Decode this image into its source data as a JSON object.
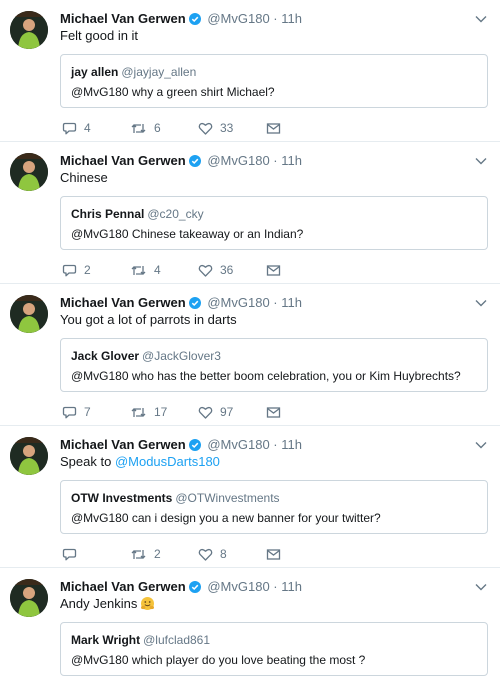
{
  "colors": {
    "accent": "#1da1f2",
    "text": "#14171a",
    "muted": "#657786",
    "border": "#ccd6dd"
  },
  "tweets": [
    {
      "name": "Michael Van Gerwen",
      "handle": "@MvG180",
      "time": "11h",
      "text": "Felt good in it",
      "mention": "",
      "emoji": "",
      "quote": {
        "name": "jay allen",
        "handle": "@jayjay_allen",
        "text": "@MvG180 why a green shirt Michael?"
      },
      "replies": "4",
      "retweets": "6",
      "likes": "33"
    },
    {
      "name": "Michael Van Gerwen",
      "handle": "@MvG180",
      "time": "11h",
      "text": "Chinese",
      "mention": "",
      "emoji": "",
      "quote": {
        "name": "Chris Pennal",
        "handle": "@c20_cky",
        "text": "@MvG180 Chinese takeaway or an Indian?"
      },
      "replies": "2",
      "retweets": "4",
      "likes": "36"
    },
    {
      "name": "Michael Van Gerwen",
      "handle": "@MvG180",
      "time": "11h",
      "text": "You got a lot of parrots in darts",
      "mention": "",
      "emoji": "",
      "quote": {
        "name": "Jack Glover",
        "handle": "@JackGlover3",
        "text": "@MvG180 who has the better boom celebration, you or Kim Huybrechts?"
      },
      "replies": "7",
      "retweets": "17",
      "likes": "97"
    },
    {
      "name": "Michael Van Gerwen",
      "handle": "@MvG180",
      "time": "11h",
      "text": "Speak to ",
      "mention": "@ModusDarts180",
      "emoji": "",
      "quote": {
        "name": "OTW Investments",
        "handle": "@OTWinvestments",
        "text": "@MvG180 can i design you a new banner for your twitter?"
      },
      "replies": "",
      "retweets": "2",
      "likes": "8"
    },
    {
      "name": "Michael Van Gerwen",
      "handle": "@MvG180",
      "time": "11h",
      "text": "Andy Jenkins",
      "mention": "",
      "emoji": "hugging-face-emoji",
      "quote": {
        "name": "Mark Wright",
        "handle": "@lufclad861",
        "text": "@MvG180 which player  do you love beating the most ?"
      },
      "replies": "",
      "retweets": "",
      "likes": ""
    }
  ],
  "separator": "·"
}
